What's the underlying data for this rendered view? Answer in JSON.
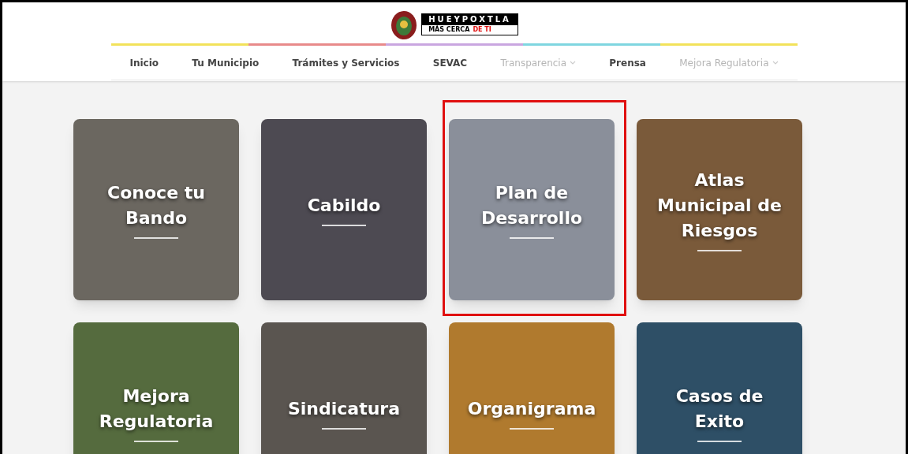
{
  "logo": {
    "name": "HUEYPOXTLA",
    "tagline": "MÁS CERCA",
    "tagline_accent": "DE TI"
  },
  "nav": [
    {
      "label": "Inicio",
      "kind": "link"
    },
    {
      "label": "Tu Municipio",
      "kind": "link"
    },
    {
      "label": "Trámites y Servicios",
      "kind": "link"
    },
    {
      "label": "SEVAC",
      "kind": "link"
    },
    {
      "label": "Transparencia",
      "kind": "dropdown"
    },
    {
      "label": "Prensa",
      "kind": "link"
    },
    {
      "label": "Mejora Regulatoria",
      "kind": "dropdown"
    }
  ],
  "cards": [
    {
      "title": "Conoce tu Bando",
      "highlighted": false
    },
    {
      "title": "Cabildo",
      "highlighted": false
    },
    {
      "title": "Plan de Desarrollo",
      "highlighted": true
    },
    {
      "title": "Atlas Municipal de Riesgos",
      "highlighted": false
    },
    {
      "title": "Mejora Regulatoria",
      "highlighted": false
    },
    {
      "title": "Sindicatura",
      "highlighted": false
    },
    {
      "title": "Organigrama",
      "highlighted": false
    },
    {
      "title": "Casos de Exito",
      "highlighted": false
    }
  ]
}
